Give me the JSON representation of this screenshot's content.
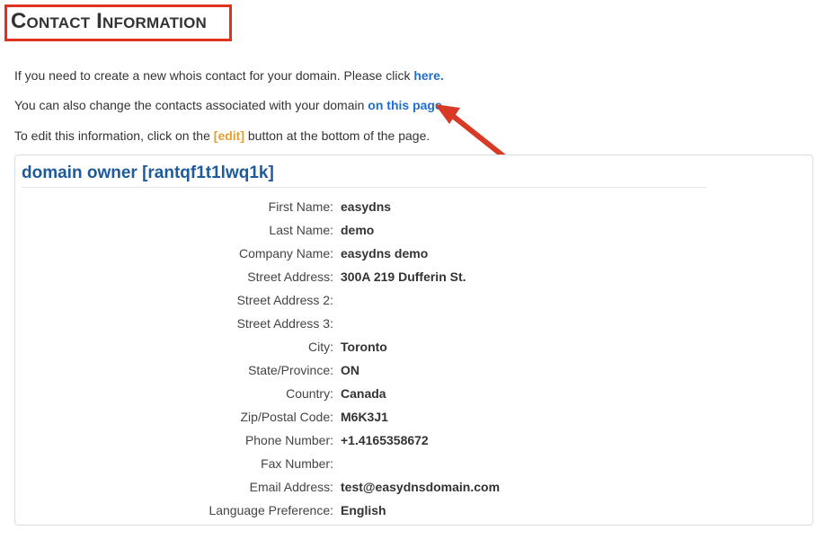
{
  "header": {
    "title": "Contact Information"
  },
  "intro": {
    "line1_text": "If you need to create a new whois contact for your domain. Please click ",
    "line1_link": "here.",
    "line2_text": "You can also change the contacts associated with your domain ",
    "line2_link": "on this page.",
    "line3_before": "To edit this information, click on the ",
    "line3_edit": "[edit]",
    "line3_after": " button at the bottom of the page."
  },
  "panel": {
    "heading": "domain owner [rantqf1t1lwq1k]",
    "fields": [
      {
        "label": "First Name:",
        "value": "easydns"
      },
      {
        "label": "Last Name:",
        "value": "demo"
      },
      {
        "label": "Company Name:",
        "value": "easydns demo"
      },
      {
        "label": "Street Address:",
        "value": "300A 219 Dufferin St."
      },
      {
        "label": "Street Address 2:",
        "value": ""
      },
      {
        "label": "Street Address 3:",
        "value": ""
      },
      {
        "label": "City:",
        "value": "Toronto"
      },
      {
        "label": "State/Province:",
        "value": "ON"
      },
      {
        "label": "Country:",
        "value": "Canada"
      },
      {
        "label": "Zip/Postal Code:",
        "value": "M6K3J1"
      },
      {
        "label": "Phone Number:",
        "value": "+1.4165358672"
      },
      {
        "label": "Fax Number:",
        "value": ""
      },
      {
        "label": "Email Address:",
        "value": "test@easydnsdomain.com"
      },
      {
        "label": "Language Preference:",
        "value": "English"
      }
    ]
  },
  "colors": {
    "link": "#1f6fd1",
    "edit": "#e2a233",
    "heading": "#1e5a9c",
    "highlight": "#e0321f"
  },
  "icons": {
    "annotation": "arrow-icon"
  }
}
